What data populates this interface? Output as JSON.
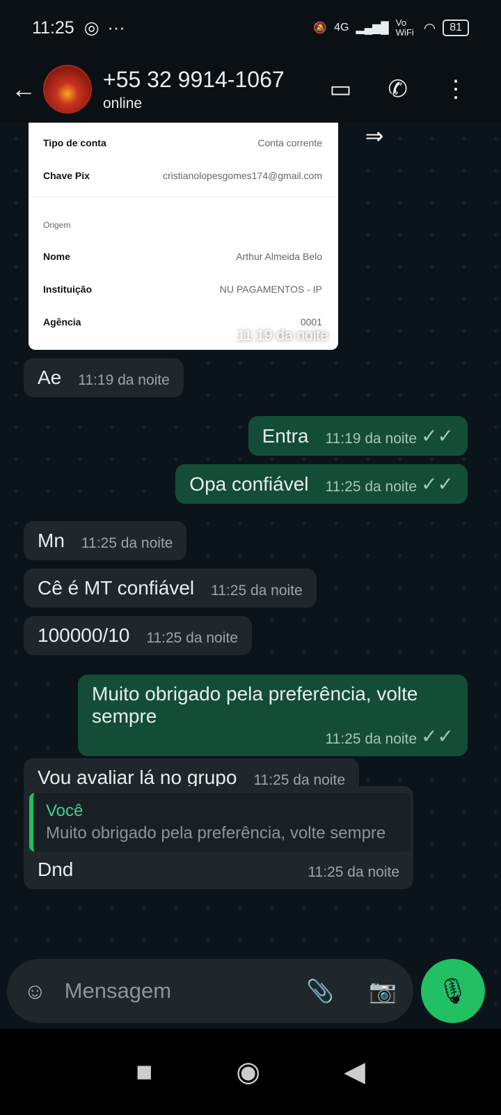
{
  "status": {
    "time": "11:25",
    "network": "4G",
    "vowifi": "Vo WiFi",
    "battery": "81"
  },
  "header": {
    "contact": "+55 32 9914-1067",
    "presence": "online"
  },
  "image_message": {
    "rows": [
      {
        "k": "Tipo de conta",
        "v": "Conta corrente"
      },
      {
        "k": "Chave Pix",
        "v": "cristianolopesgomes174@gmail.com"
      }
    ],
    "section": "Origem",
    "rows2": [
      {
        "k": "Nome",
        "v": "Arthur Almeida Belo"
      },
      {
        "k": "Instituição",
        "v": "NU PAGAMENTOS - IP"
      },
      {
        "k": "Agência",
        "v": "0001"
      }
    ],
    "time": "11:19 da noite"
  },
  "messages": [
    {
      "text": "Ae",
      "time": "11:19 da noite"
    },
    {
      "text": "Entra",
      "time": "11:19 da noite"
    },
    {
      "text": "Opa confiável",
      "time": "11:25 da noite"
    },
    {
      "text": "Mn",
      "time": "11:25 da noite"
    },
    {
      "text": "Cê é MT confiável",
      "time": "11:25 da noite"
    },
    {
      "text": "100000/10",
      "time": "11:25 da noite"
    },
    {
      "text": "Muito obrigado pela preferência, volte sempre",
      "time": "11:25 da noite"
    },
    {
      "text": "Vou avaliar lá no grupo",
      "time": "11:25 da noite"
    },
    {
      "text": "Dnd",
      "time": "11:25 da noite",
      "quote_author": "Você",
      "quote_text": "Muito obrigado pela preferência, volte sempre"
    }
  ],
  "composer": {
    "placeholder": "Mensagem"
  }
}
